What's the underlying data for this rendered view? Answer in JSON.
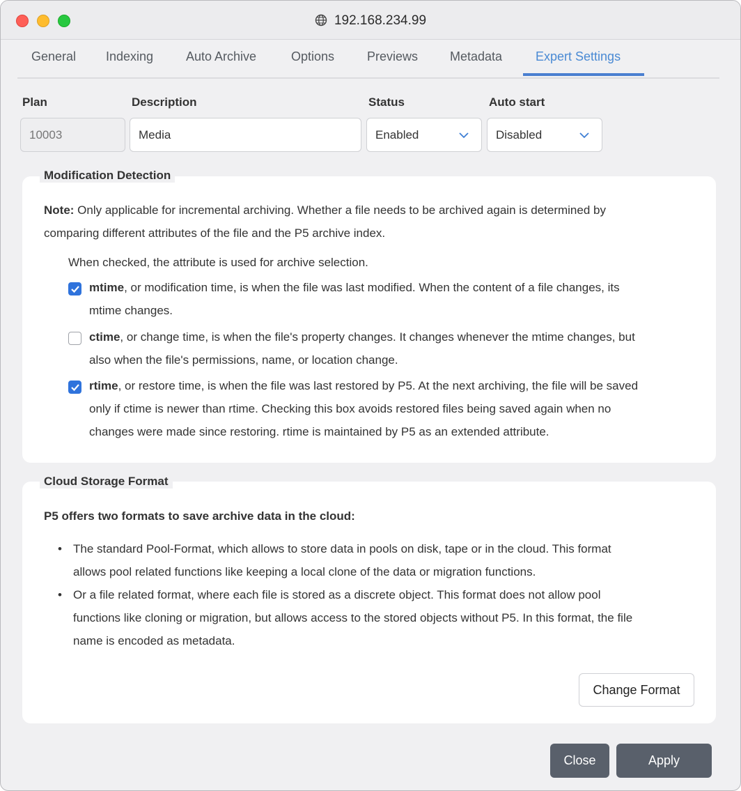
{
  "window": {
    "title": "192.168.234.99"
  },
  "tabs": [
    {
      "label": "General",
      "active": false
    },
    {
      "label": "Indexing",
      "active": false
    },
    {
      "label": "Auto Archive",
      "active": false
    },
    {
      "label": "Options",
      "active": false
    },
    {
      "label": "Previews",
      "active": false
    },
    {
      "label": "Metadata",
      "active": false
    },
    {
      "label": "Expert Settings",
      "active": true
    }
  ],
  "fields": {
    "plan": {
      "label": "Plan",
      "value": "10003"
    },
    "description": {
      "label": "Description",
      "value": "Media"
    },
    "status": {
      "label": "Status",
      "value": "Enabled"
    },
    "auto_start": {
      "label": "Auto start",
      "value": "Disabled"
    }
  },
  "modification_detection": {
    "legend": "Modification Detection",
    "note_label": "Note:",
    "note_line1": " Only applicable for incremental archiving. Whether a file needs to be archived again is determined by",
    "note_line2": "comparing different attributes of the file and the P5 archive index.",
    "intro": "When checked, the attribute is used for archive selection.",
    "options": [
      {
        "checked": true,
        "term": "mtime",
        "line1": ", or modification time, is when the file was last modified. When the content of a file changes, its",
        "line2": "mtime changes.",
        "line3": ""
      },
      {
        "checked": false,
        "term": "ctime",
        "line1": ", or change time, is when the file's property changes. It changes whenever the mtime changes, but",
        "line2": "also when the file's permissions, name, or location change.",
        "line3": ""
      },
      {
        "checked": true,
        "term": "rtime",
        "line1": ", or restore time, is when the file was last restored by P5. At the next archiving, the file will be saved",
        "line2": "only if ctime is newer than rtime. Checking this box avoids restored files being saved again when no",
        "line3": "changes were made since restoring. rtime is maintained by P5 as an extended attribute."
      }
    ]
  },
  "cloud_storage": {
    "legend": "Cloud Storage Format",
    "heading": "P5 offers two formats to save archive data in the cloud:",
    "bullets": [
      {
        "line1": "The standard Pool-Format, which allows to store data in pools on disk, tape or in the cloud. This format",
        "line2": "allows pool related functions like keeping a local clone of the data or migration functions.",
        "line3": ""
      },
      {
        "line1": "Or a file related format, where each file is stored as a discrete object. This format does not allow pool",
        "line2": "functions like cloning or migration, but allows access to the stored objects without P5. In this format, the file",
        "line3": "name is encoded as metadata."
      }
    ],
    "change_button": "Change Format"
  },
  "footer": {
    "close_label": "Close",
    "apply_label": "Apply"
  },
  "colors": {
    "accent": "#4a8ad4",
    "checkbox": "#2f73dc",
    "dark_button": "#59606b"
  }
}
